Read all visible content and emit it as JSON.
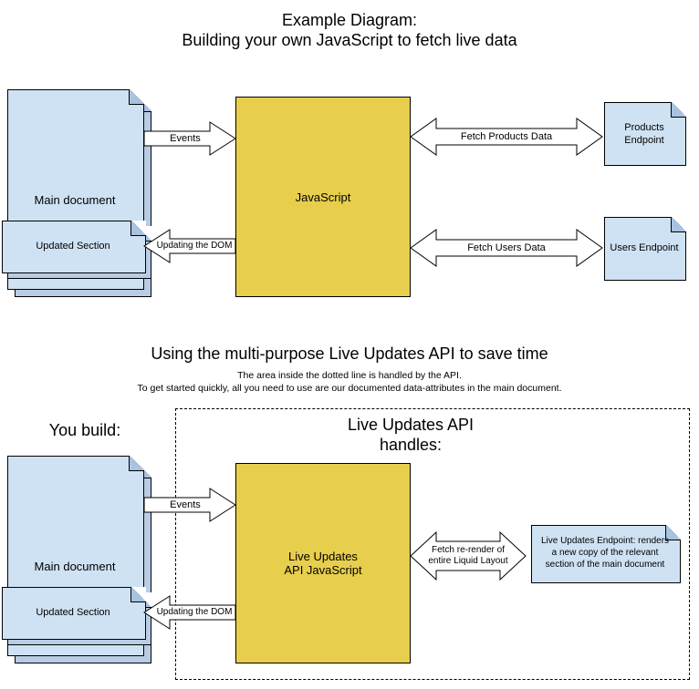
{
  "titles": {
    "line1": "Example Diagram:",
    "line2": "Building your own JavaScript to fetch live data",
    "section2": "Using the multi-purpose Live Updates API to save time",
    "sub1": "The area inside the dotted line is handled by the API.",
    "sub2": "To get started quickly, all you need to use are our documented data-attributes in the main document."
  },
  "top": {
    "main_doc": "Main document",
    "updated_section": "Updated Section",
    "js": "JavaScript",
    "events": "Events",
    "updating_dom": "Updating the DOM",
    "fetch_products": "Fetch Products Data",
    "fetch_users": "Fetch Users Data",
    "products_ep_l1": "Products",
    "products_ep_l2": "Endpoint",
    "users_ep": "Users Endpoint"
  },
  "bottom": {
    "you_build": "You build:",
    "api_handles_l1": "Live Updates API",
    "api_handles_l2": "handles:",
    "main_doc": "Main document",
    "updated_section": "Updated Section",
    "js_l1": "Live Updates",
    "js_l2": "API JavaScript",
    "events": "Events",
    "updating_dom": "Updating the DOM",
    "fetch_rerender_l1": "Fetch re-render of",
    "fetch_rerender_l2": "entire Liquid Layout",
    "endpoint_note_l1": "Live Updates Endpoint: renders",
    "endpoint_note_l2": "a new copy of the relevant",
    "endpoint_note_l3": "section of the main document"
  }
}
